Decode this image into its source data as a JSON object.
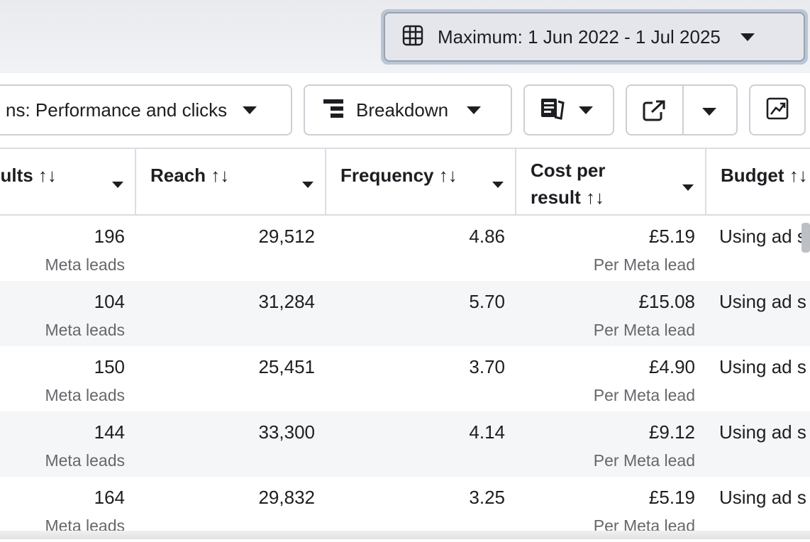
{
  "date_range": {
    "label": "Maximum: 1 Jun 2022 - 1 Jul 2025",
    "icon": "calendar-table-icon"
  },
  "toolbar": {
    "columns_label": "ns: Performance and clicks",
    "breakdown_label": "Breakdown",
    "reports_icon": "reports-icon",
    "export_icon": "export-icon",
    "chart_icon": "chart-icon"
  },
  "table": {
    "headers": {
      "results": "sults ↑↓",
      "reach": "Reach ↑↓",
      "frequency": "Frequency ↑↓",
      "cost_line1": "Cost per",
      "cost_line2": "result ↑↓",
      "budget": "Budget ↑↓"
    },
    "rows": [
      {
        "results": "196",
        "results_sub": "Meta leads",
        "reach": "29,512",
        "frequency": "4.86",
        "cost": "£5.19",
        "cost_sub": "Per Meta lead",
        "budget": "Using ad s"
      },
      {
        "results": "104",
        "results_sub": "Meta leads",
        "reach": "31,284",
        "frequency": "5.70",
        "cost": "£15.08",
        "cost_sub": "Per Meta lead",
        "budget": "Using ad s"
      },
      {
        "results": "150",
        "results_sub": "Meta leads",
        "reach": "25,451",
        "frequency": "3.70",
        "cost": "£4.90",
        "cost_sub": "Per Meta lead",
        "budget": "Using ad s"
      },
      {
        "results": "144",
        "results_sub": "Meta leads",
        "reach": "33,300",
        "frequency": "4.14",
        "cost": "£9.12",
        "cost_sub": "Per Meta lead",
        "budget": "Using ad s"
      },
      {
        "results": "164",
        "results_sub": "Meta leads",
        "reach": "29,832",
        "frequency": "3.25",
        "cost": "£5.19",
        "cost_sub": "Per Meta lead",
        "budget": "Using ad s"
      }
    ]
  }
}
